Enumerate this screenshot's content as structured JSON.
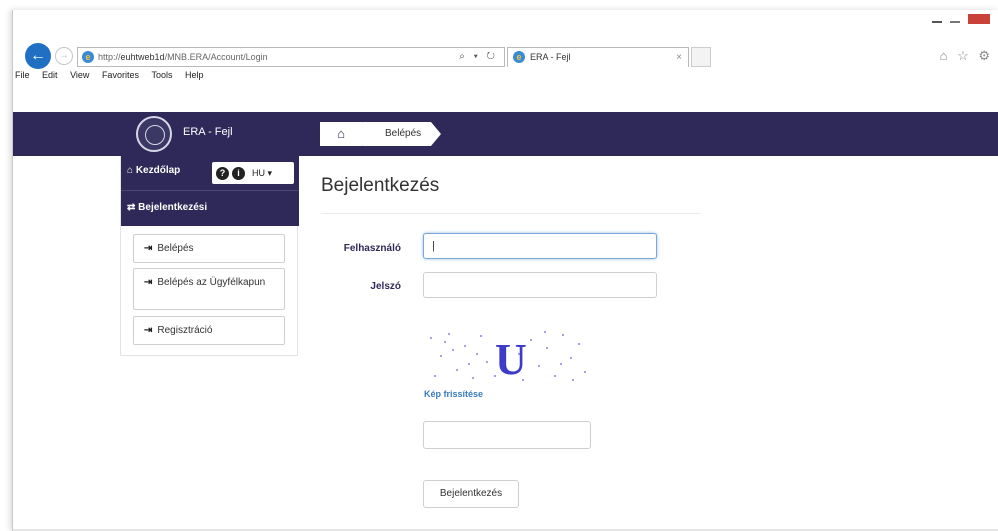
{
  "browser": {
    "url_prefix": "http://",
    "url_host": "euhtweb1d",
    "url_path": "/MNB.ERA/Account/Login",
    "url_actions": "⌕ ▾ ↻",
    "tab_title": "ERA - Fejl",
    "tab_close": "×",
    "ie_icon": "e",
    "back_icon": "←",
    "forward_icon": "→",
    "right_icons": "⌂ ☆ ⚙",
    "menu": [
      "File",
      "Edit",
      "View",
      "Favorites",
      "Tools",
      "Help"
    ]
  },
  "header": {
    "app_title": "ERA - Fejl",
    "home_icon": "⌂",
    "breadcrumb_current": "Belépés",
    "brand_color": "#2e2958"
  },
  "sidebar": {
    "home_label": "Kezdőlap",
    "home_icon": "⌂",
    "help_icon": "?",
    "info_icon": "i",
    "language": "HU ▾",
    "section_icon": "⇄",
    "section_title": "Bejelentkezési",
    "items": [
      {
        "icon": "⇥",
        "label": "Belépés"
      },
      {
        "icon": "⇥",
        "label": "Belépés az Ügyfélkapun"
      },
      {
        "icon": "⇥",
        "label": "Regisztráció"
      }
    ]
  },
  "form": {
    "title": "Bejelentkezés",
    "username_label": "Felhasználó",
    "username_value": "|",
    "password_label": "Jelszó",
    "password_value": "",
    "captcha_text": "U",
    "refresh_link": "Kép frissítése",
    "captcha_input_value": "",
    "submit_label": "Bejelentkezés"
  }
}
